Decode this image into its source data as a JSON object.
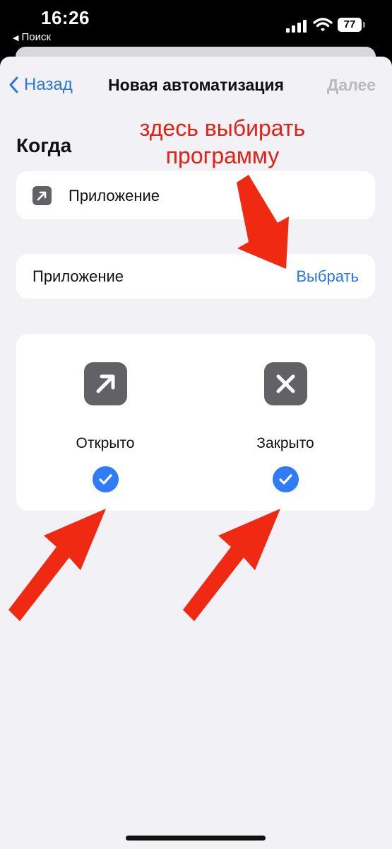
{
  "status": {
    "time": "16:26",
    "back_app": "Поиск",
    "battery": "77"
  },
  "nav": {
    "back_label": "Назад",
    "title": "Новая автоматизация",
    "next_label": "Далее"
  },
  "when": {
    "title": "Когда",
    "trigger_label": "Приложение",
    "trigger_icon": "arrow-up-right-icon",
    "app_row_label": "Приложение",
    "choose_label": "Выбрать"
  },
  "options": [
    {
      "label": "Открыто",
      "icon": "arrow-up-right-icon",
      "checked": true
    },
    {
      "label": "Закрыто",
      "icon": "close-x-icon",
      "checked": true
    }
  ],
  "annotation": {
    "line1": "здесь выбирать",
    "line2": "программу",
    "color": "#e52012"
  },
  "colors": {
    "accent": "#2878e0",
    "check": "#2f7cf6",
    "icon_tile": "#616166",
    "background": "#f1f1f6"
  }
}
